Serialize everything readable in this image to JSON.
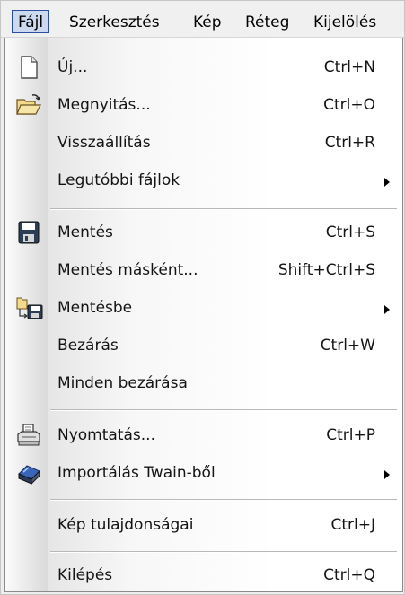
{
  "menubar": {
    "items": [
      "Fájl",
      "Szerkesztés",
      "Kép",
      "Réteg",
      "Kijelölés"
    ]
  },
  "menu": {
    "items": [
      {
        "label": "Új...",
        "shortcut": "Ctrl+N",
        "icon": "new-document-icon"
      },
      {
        "label": "Megnyitás...",
        "shortcut": "Ctrl+O",
        "icon": "open-folder-icon"
      },
      {
        "label": "Visszaállítás",
        "shortcut": "Ctrl+R"
      },
      {
        "label": "Legutóbbi fájlok",
        "submenu": true
      },
      {
        "label": "Mentés",
        "shortcut": "Ctrl+S",
        "icon": "save-floppy-icon"
      },
      {
        "label": "Mentés másként...",
        "shortcut": "Shift+Ctrl+S"
      },
      {
        "label": "Mentésbe",
        "submenu": true,
        "icon": "save-to-icon"
      },
      {
        "label": "Bezárás",
        "shortcut": "Ctrl+W"
      },
      {
        "label": "Minden bezárása"
      },
      {
        "label": "Nyomtatás...",
        "shortcut": "Ctrl+P",
        "icon": "printer-icon"
      },
      {
        "label": "Importálás Twain-ből",
        "submenu": true,
        "icon": "scanner-icon"
      },
      {
        "label": "Kép tulajdonságai",
        "shortcut": "Ctrl+J"
      },
      {
        "label": "Kilépés",
        "shortcut": "Ctrl+Q"
      }
    ]
  }
}
